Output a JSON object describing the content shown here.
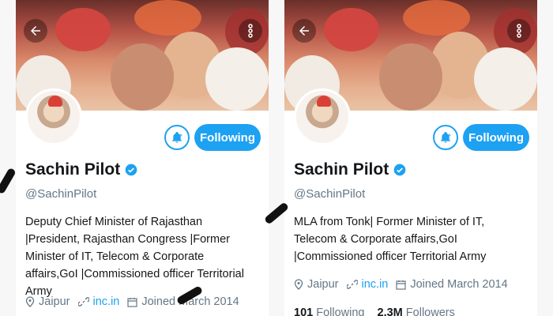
{
  "colors": {
    "accent": "#1da1f2",
    "text": "#14171a",
    "muted": "#657786"
  },
  "icons": [
    "arrow-left-icon",
    "more-vertical-icon",
    "bell-plus-icon",
    "verified-badge-icon",
    "location-icon",
    "link-icon",
    "calendar-icon"
  ],
  "left": {
    "follow_label": "Following",
    "name": "Sachin Pilot",
    "handle": "@SachinPilot",
    "bio": "Deputy Chief Minister of Rajasthan |President, Rajasthan Congress |Former Minister of IT, Telecom & Corporate affairs,GoI |Commissioned officer Territorial Army",
    "location": "Jaipur",
    "website": "inc.in",
    "joined": "Joined March 2014"
  },
  "right": {
    "follow_label": "Following",
    "name": "Sachin Pilot",
    "handle": "@SachinPilot",
    "bio": "MLA from Tonk| Former Minister of IT, Telecom & Corporate affairs,GoI |Commissioned officer Territorial Army",
    "location": "Jaipur",
    "website": "inc.in",
    "joined": "Joined March 2014",
    "following_count": "101",
    "following_label": "Following",
    "followers_count": "2.3M",
    "followers_label": "Followers"
  }
}
